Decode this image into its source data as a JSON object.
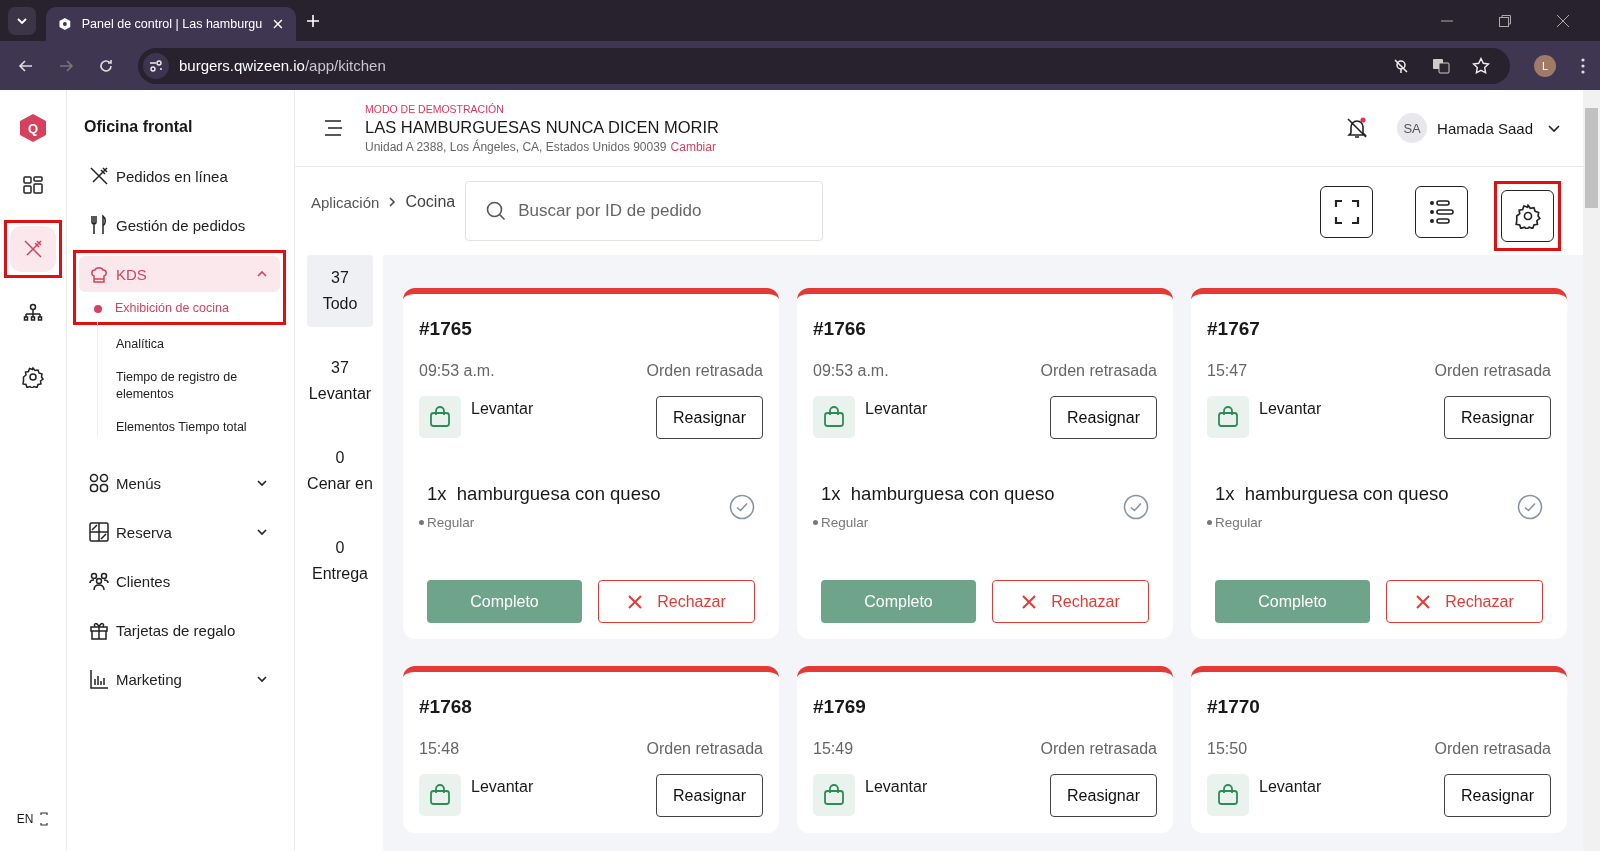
{
  "browser": {
    "tab_title": "Panel de control | Las hamburgu",
    "url_host": "burgers.qwizeen.io",
    "url_path": "/app/kitchen",
    "profile_initial": "L"
  },
  "rail": {
    "logo_letter": "Q",
    "items": [
      {
        "selected": false,
        "highlighted": false
      },
      {
        "selected": true,
        "highlighted": true
      },
      {
        "selected": false,
        "highlighted": false
      },
      {
        "selected": false,
        "highlighted": false
      }
    ],
    "language": "EN"
  },
  "sidebar": {
    "title": "Oficina frontal",
    "items": [
      {
        "label": "Pedidos en línea",
        "expandable": false,
        "selected": false
      },
      {
        "label": "Gestión de pedidos",
        "expandable": false,
        "selected": false
      },
      {
        "label": "KDS",
        "expandable": true,
        "expanded": true,
        "selected": true,
        "highlighted": true,
        "children": [
          {
            "label": "Exhibición de cocina",
            "selected": true
          },
          {
            "label": "Analítica",
            "selected": false
          },
          {
            "label": "Tiempo de registro de elementos",
            "selected": false
          },
          {
            "label": "Elementos Tiempo total",
            "selected": false
          }
        ]
      },
      {
        "label": "Menús",
        "expandable": true,
        "expanded": false,
        "selected": false
      },
      {
        "label": "Reserva",
        "expandable": true,
        "expanded": false,
        "selected": false
      },
      {
        "label": "Clientes",
        "expandable": false,
        "selected": false
      },
      {
        "label": "Tarjetas de regalo",
        "expandable": false,
        "selected": false
      },
      {
        "label": "Marketing",
        "expandable": true,
        "expanded": false,
        "selected": false
      }
    ]
  },
  "header": {
    "mode": "MODO DE DEMOSTRACIÓN",
    "restaurant": "LAS HAMBURGUESAS NUNCA DICEN MORIR",
    "address": "Unidad A 2388, Los Ángeles, CA, Estados Unidos 90039",
    "change_link": "Cambiar",
    "user_initials": "SA",
    "user_name": "Hamada Saad"
  },
  "toolbar": {
    "breadcrumb": [
      "Aplicación",
      "Cocina"
    ],
    "search": {
      "placeholder": "Buscar por ID de pedido"
    },
    "settings_highlighted": true
  },
  "filters": [
    {
      "count": "37",
      "label": "Todo",
      "selected": true
    },
    {
      "count": "37",
      "label": "Levantar",
      "selected": false
    },
    {
      "count": "0",
      "label": "Cenar en",
      "selected": false
    },
    {
      "count": "0",
      "label": "Entrega",
      "selected": false
    }
  ],
  "orders": [
    {
      "number": "#1765",
      "time": "09:53 a.m.",
      "status": "Orden retrasada",
      "type": "Levantar",
      "reassign": "Reasignar",
      "items": [
        {
          "qty": "1x",
          "name": "hamburguesa con queso",
          "modifier": "Regular"
        }
      ],
      "complete": "Completo",
      "reject": "Rechazar"
    },
    {
      "number": "#1766",
      "time": "09:53 a.m.",
      "status": "Orden retrasada",
      "type": "Levantar",
      "reassign": "Reasignar",
      "items": [
        {
          "qty": "1x",
          "name": "hamburguesa con queso",
          "modifier": "Regular"
        }
      ],
      "complete": "Completo",
      "reject": "Rechazar"
    },
    {
      "number": "#1767",
      "time": "15:47",
      "status": "Orden retrasada",
      "type": "Levantar",
      "reassign": "Reasignar",
      "items": [
        {
          "qty": "1x",
          "name": "hamburguesa con queso",
          "modifier": "Regular"
        }
      ],
      "complete": "Completo",
      "reject": "Rechazar"
    },
    {
      "number": "#1768",
      "time": "15:48",
      "status": "Orden retrasada",
      "type": "Levantar",
      "reassign": "Reasignar"
    },
    {
      "number": "#1769",
      "time": "15:49",
      "status": "Orden retrasada",
      "type": "Levantar",
      "reassign": "Reasignar"
    },
    {
      "number": "#1770",
      "time": "15:50",
      "status": "Orden retrasada",
      "type": "Levantar",
      "reassign": "Reasignar"
    }
  ]
}
